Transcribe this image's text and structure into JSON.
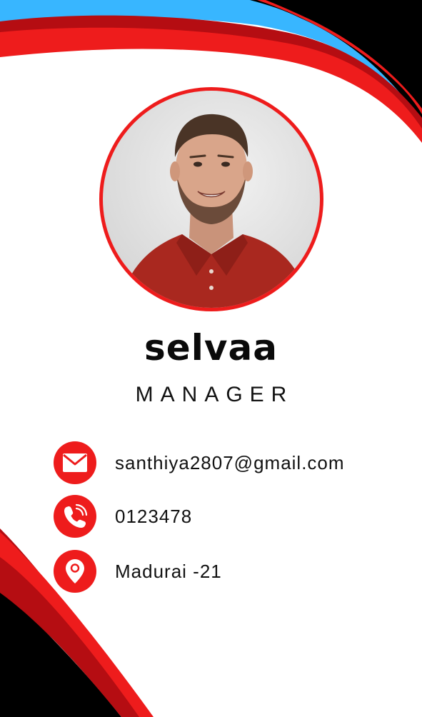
{
  "profile": {
    "name": "selvaa",
    "role": "MANAGER"
  },
  "contacts": [
    {
      "type": "email",
      "icon": "mail-icon",
      "value": "santhiya2807@gmail.com"
    },
    {
      "type": "phone",
      "icon": "phone-icon",
      "value": "0123478"
    },
    {
      "type": "address",
      "icon": "location-pin-icon",
      "value": "Madurai -21"
    }
  ],
  "colors": {
    "accent_red": "#ee1c1c",
    "dark_red": "#b50d12",
    "sky_blue": "#38b6ff",
    "black": "#000000",
    "photo_bg": "#e6e6e6",
    "shirt_red": "#a9281f"
  }
}
